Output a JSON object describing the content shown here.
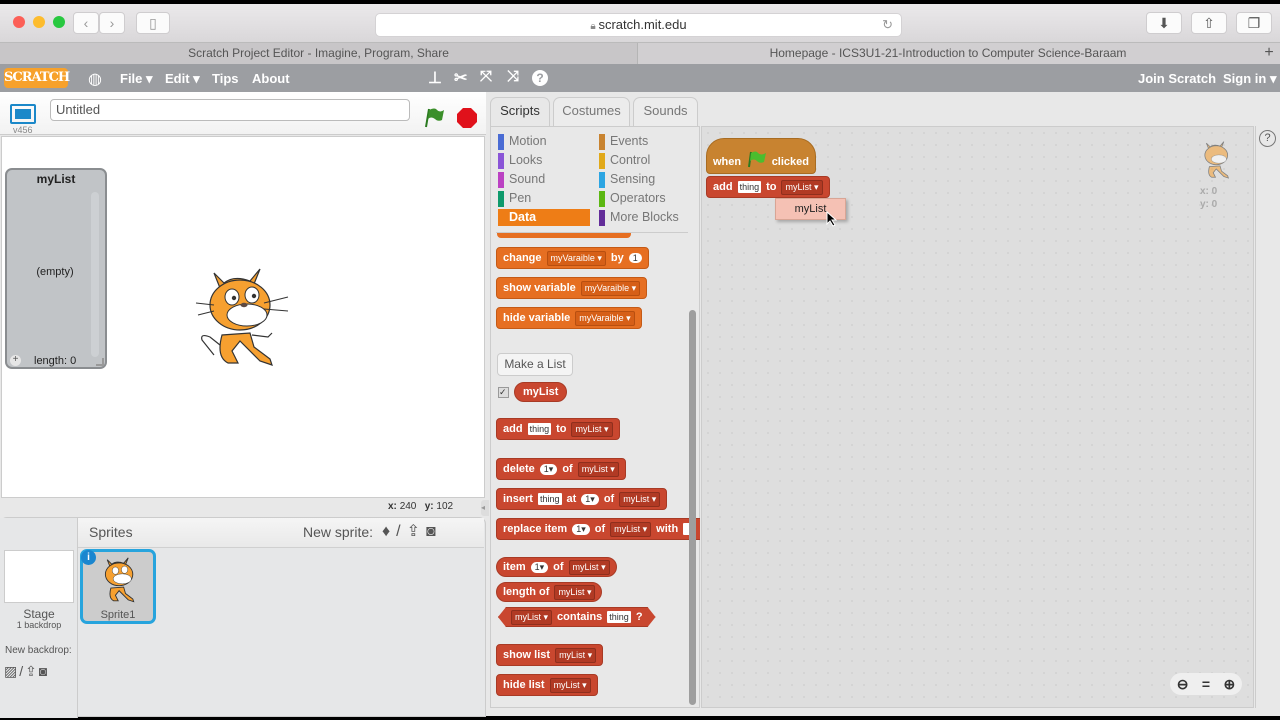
{
  "browser": {
    "url": "scratch.mit.edu",
    "tabs": [
      {
        "label": "Scratch Project Editor - Imagine, Program, Share",
        "active": true
      },
      {
        "label": "Homepage - ICS3U1-21-Introduction to Computer Science-Baraam",
        "active": false
      }
    ],
    "new_tab_icon": "plus"
  },
  "menubar": {
    "logo": "SCRATCH",
    "items": [
      "File ▾",
      "Edit ▾",
      "Tips",
      "About"
    ],
    "tools": [
      "stamp-icon",
      "cut-icon",
      "grow-icon",
      "shrink-icon",
      "help-icon"
    ],
    "join": "Join Scratch",
    "signin": "Sign in ▾"
  },
  "stage": {
    "version": "v456",
    "project_title": "Untitled",
    "list_monitor": {
      "name": "myList",
      "content": "(empty)",
      "length_label": "length: 0",
      "add": "+"
    },
    "mouse_x_label": "x:",
    "mouse_x": "240",
    "mouse_y_label": "y:",
    "mouse_y": "102"
  },
  "sprites": {
    "header": "Sprites",
    "new_sprite_label": "New sprite:",
    "stage_label": "Stage",
    "stage_sub": "1 backdrop",
    "new_backdrop_label": "New backdrop:",
    "items": [
      {
        "name": "Sprite1",
        "selected": true
      }
    ]
  },
  "palette": {
    "tabs": [
      "Scripts",
      "Costumes",
      "Sounds"
    ],
    "active_tab": "Scripts",
    "categories_left": [
      {
        "label": "Motion",
        "color": "#4a6cd4"
      },
      {
        "label": "Looks",
        "color": "#8a55d7"
      },
      {
        "label": "Sound",
        "color": "#bb42c3"
      },
      {
        "label": "Pen",
        "color": "#0e9a6c"
      },
      {
        "label": "Data",
        "color": "#ee7d16",
        "active": true
      }
    ],
    "categories_right": [
      {
        "label": "Events",
        "color": "#c88330"
      },
      {
        "label": "Control",
        "color": "#e1a91a"
      },
      {
        "label": "Sensing",
        "color": "#2ca5e2"
      },
      {
        "label": "Operators",
        "color": "#5cb712"
      },
      {
        "label": "More Blocks",
        "color": "#632d99"
      }
    ],
    "var_blocks": {
      "change": "change",
      "by": "by",
      "var": "myVaraible",
      "one": "1",
      "show_variable": "show variable",
      "hide_variable": "hide variable"
    },
    "make_list": "Make a List",
    "list_name": "myList",
    "list_blocks": {
      "add": "add",
      "thing": "thing",
      "to": "to",
      "delete": "delete",
      "of": "of",
      "insert": "insert",
      "at": "at",
      "replace_item": "replace item",
      "with": "with",
      "item": "item",
      "length_of": "length of",
      "contains": "contains",
      "q": "?",
      "show_list": "show list",
      "hide_list": "hide list",
      "idx": "1▾"
    }
  },
  "scripts": {
    "hat": {
      "when": "when",
      "clicked": "clicked"
    },
    "add_block": {
      "add": "add",
      "thing": "thing",
      "to": "to",
      "list": "myList"
    },
    "dropdown_option": "myList",
    "sprite_x": "x: 0",
    "sprite_y": "y: 0",
    "zoom": [
      "zoom-out",
      "zoom-reset",
      "zoom-in"
    ]
  }
}
